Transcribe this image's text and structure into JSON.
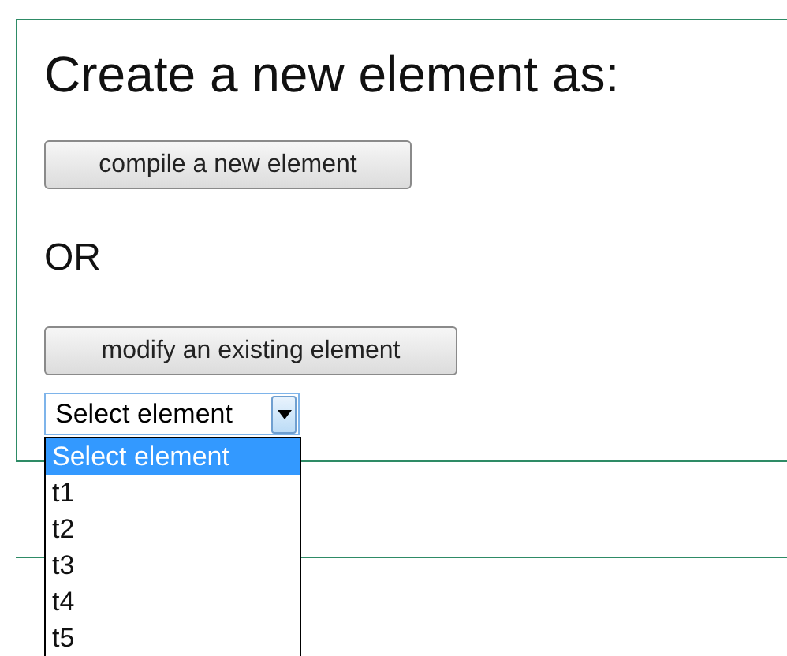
{
  "heading": "Create a new element as:",
  "compile_button": "compile a new element",
  "or_label": "OR",
  "modify_button": "modify an existing element",
  "select": {
    "value": "Select element",
    "expanded": true,
    "options": [
      {
        "label": "Select element",
        "selected": true
      },
      {
        "label": "t1",
        "selected": false
      },
      {
        "label": "t2",
        "selected": false
      },
      {
        "label": "t3",
        "selected": false
      },
      {
        "label": "t4",
        "selected": false
      },
      {
        "label": "t5",
        "selected": false
      }
    ]
  }
}
